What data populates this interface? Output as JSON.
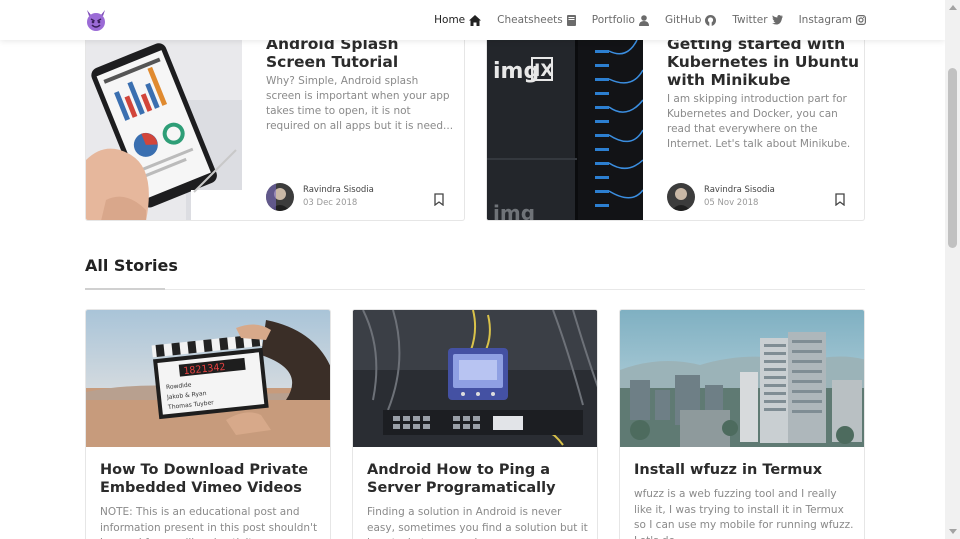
{
  "nav": {
    "items": [
      {
        "label": "Home",
        "icon": "home-icon"
      },
      {
        "label": "Cheatsheets",
        "icon": "book-icon"
      },
      {
        "label": "Portfolio",
        "icon": "user-icon"
      },
      {
        "label": "GitHub",
        "icon": "github-icon"
      },
      {
        "label": "Twitter",
        "icon": "twitter-icon"
      },
      {
        "label": "Instagram",
        "icon": "instagram-icon"
      }
    ],
    "active": "Home",
    "logo_icon": "devil-emoji-icon"
  },
  "featured": [
    {
      "title": "Android Splash Screen Tutorial",
      "excerpt": "Why? Simple, Android splash screen is important when your app takes time to open, it is not required on all apps but it is need...",
      "author": "Ravindra Sisodia",
      "date": "03 Dec 2018"
    },
    {
      "title": "Getting started with Kubernetes in Ubuntu with Minikube",
      "excerpt": "I am skipping introduction part for Kubernetes and Docker, you can read that everywhere on the Internet. Let's talk about Minikube.",
      "author": "Ravindra Sisodia",
      "date": "05 Nov 2018",
      "image_text": "imgIX"
    }
  ],
  "section": {
    "title": "All Stories"
  },
  "stories": [
    {
      "title": "How To Download Private Embedded Vimeo Videos",
      "excerpt": "NOTE: This is an educational post and information present in this post shouldn't be used for any illegal activity.",
      "image_text": {
        "time": "1821342",
        "line1": "Rowdide",
        "line2": "Jakob & Ryan",
        "line3": "Thomas Tuyber"
      }
    },
    {
      "title": "Android How to Ping a Server Programatically",
      "excerpt": "Finding a solution in Android is never easy, sometimes you find a solution but it is not what you need."
    },
    {
      "title": "Install wfuzz in Termux",
      "excerpt": "wfuzz is a web fuzzing tool and I really like it, I was trying to install it in Termux so I can use my mobile for running wfuzz. Let's do"
    }
  ],
  "colors": {
    "text_dark": "#2b2b2b",
    "text_muted": "#8a8a8a",
    "accent_logo": "#8e5cc9"
  }
}
